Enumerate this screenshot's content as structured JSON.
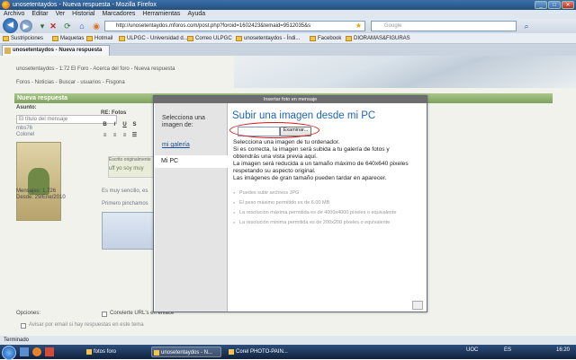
{
  "window": {
    "title": "unosetentaydos - Nueva respuesta - Mozilla Firefox",
    "minimize": "_",
    "maximize": "□",
    "close": "✕"
  },
  "menu": [
    "Archivo",
    "Editar",
    "Ver",
    "Historial",
    "Marcadores",
    "Herramientas",
    "Ayuda"
  ],
  "navbar": {
    "url": "http://unosetentaydos.mforos.com/post.php?foroid=1602423&temaid=9512035&s",
    "search_placeholder": "Google"
  },
  "bookmarks": [
    "Sustripciones",
    "Maquetas",
    "Hotmail",
    "ULPGC - Universidad d...",
    "Correo ULPGC",
    "unosetentaydos - Índi...",
    "Facebook",
    "DIORAMAS&FIGURAS"
  ],
  "tab": {
    "label": "unosetentaydos - Nueva respuesta"
  },
  "forum": {
    "breadcrumb": "unosetentaydos - 1:72 El Foro - Acerca del foro - Nueva respuesta",
    "links": "Foros - Noticias - Buscar - usuarios - Fisgona",
    "section_title": "Nueva respuesta",
    "asunto_label": "Asunto:",
    "asunto_value": "El título del mensaje",
    "user_name": "mbs76",
    "user_rank": "Colonel",
    "re_label": "RE: Fotos",
    "messages": "Mensajes: 1.726",
    "since": "Desde: 29/Ene/2010",
    "quote_title": "Escrito originalmente",
    "quote_text": "uff yo soy muy",
    "body_text_1": "Es muy sencillo, es",
    "body_text_2": "Primero pinchamos",
    "opciones_label": "Opciones:",
    "option_1": "Convierte URL's en enlace",
    "option_2": "Avisar por email si hay respuestas en este tema"
  },
  "modal": {
    "title": "Insertar foto en mensaje",
    "side_heading": "Selecciona una imagen de:",
    "side_gallery": "mi galería",
    "side_pc": "Mi PC",
    "heading": "Subir una imagen desde mi PC",
    "browse_button": "Examinar...",
    "descriptions": [
      "Selecciona una imagen de tu ordenador.",
      "Si es correcta, la imagen será subida a tu galería de fotos y",
      "obtendrás una vista previa aquí.",
      "La imagen será reducida a un tamaño máximo de 640x640 pixeles",
      "respetando su aspecto original.",
      "Las imágenes de gran tamaño pueden tardar en aparecer."
    ],
    "rules": [
      "Puedes subir archivos JPG",
      "El peso máximo permitido es de 6.00 MB",
      "La resolución máxima permitida es de 4000x4000 píxeles o equivalente",
      "La resolución mínima permitida es de 200x200 píxeles o equivalente"
    ]
  },
  "statusbar": {
    "text": "Terminado"
  },
  "taskbar": {
    "items": [
      "fotos foro",
      "unosetentaydos - N...",
      "Corel PHOTO-PAIN..."
    ],
    "lang": "ES",
    "uoc": "UOC",
    "time": "16:20"
  }
}
